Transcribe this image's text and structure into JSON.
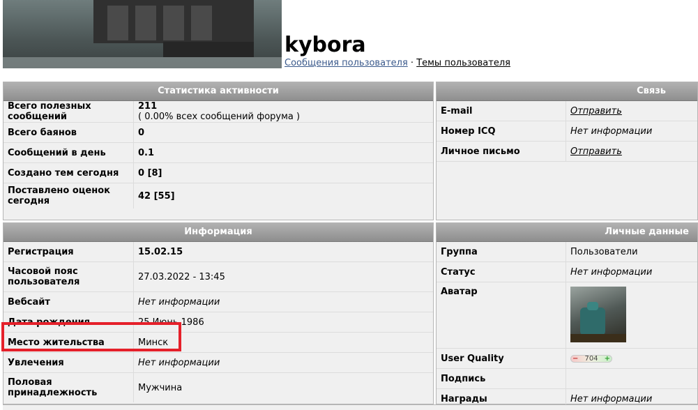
{
  "profile": {
    "username": "kybora",
    "link_posts": "Сообщения пользователя",
    "link_sep": "·",
    "link_topics": "Темы пользователя"
  },
  "activity": {
    "title": "Статистика активности",
    "rows": [
      {
        "label": "Всего полезных сообщений",
        "value": "211",
        "sub": "( 0.00% всех сообщений форума )"
      },
      {
        "label": "Всего баянов",
        "value": "0"
      },
      {
        "label": "Сообщений в день",
        "value": "0.1"
      },
      {
        "label": "Создано тем сегодня",
        "value": "0 [8]"
      },
      {
        "label": "Поставлено оценок сегодня",
        "value": "42 [55]"
      }
    ]
  },
  "contact": {
    "title": "Связь",
    "rows": [
      {
        "label": "E-mail",
        "value": "Отправить"
      },
      {
        "label": "Номер ICQ",
        "value": "Нет информации"
      },
      {
        "label": "Личное письмо",
        "value": "Отправить"
      }
    ]
  },
  "info": {
    "title": "Информация",
    "rows": [
      {
        "label": "Регистрация",
        "value": "15.02.15"
      },
      {
        "label": "Часовой пояс пользователя",
        "value": "27.03.2022 - 13:45"
      },
      {
        "label": "Вебсайт",
        "value": "Нет информации"
      },
      {
        "label": "Дата рождения",
        "value": "25 Июнь 1986"
      },
      {
        "label": "Место жительства",
        "value": "Минск"
      },
      {
        "label": "Увлечения",
        "value": "Нет информации"
      },
      {
        "label": "Половая принадлежность",
        "value": "Мужчина"
      }
    ]
  },
  "personal": {
    "title": "Личные данные",
    "rows": [
      {
        "label": "Группа",
        "value": "Пользователи"
      },
      {
        "label": "Статус",
        "value": "Нет информации"
      },
      {
        "label": "Аватар"
      },
      {
        "label": "User Quality",
        "minus": "−",
        "value": "704",
        "plus": "+"
      },
      {
        "label": "Подпись",
        "value": ""
      },
      {
        "label": "Награды",
        "value": "Нет информации"
      }
    ]
  },
  "colors": {
    "panel_header": "#9d9d9d",
    "panel_bg": "#f0f0f0",
    "highlight": "#e5202a",
    "link": "#3b5a8c"
  }
}
